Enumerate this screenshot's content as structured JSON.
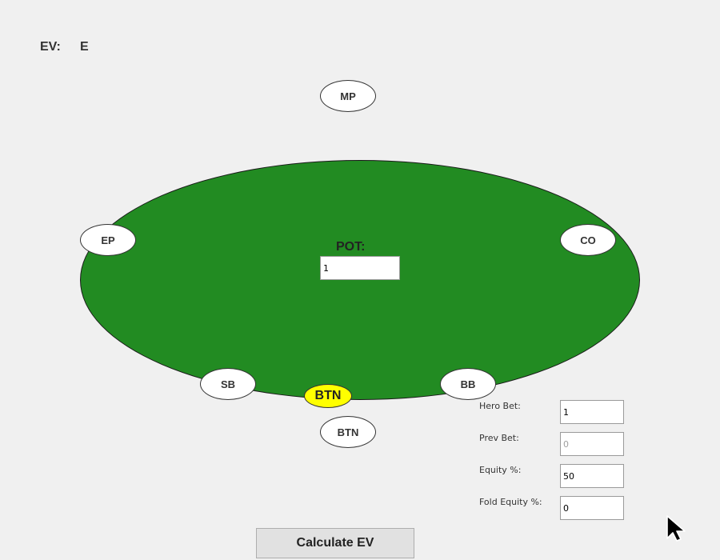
{
  "ev": {
    "label": "EV:",
    "value": "E"
  },
  "table": {
    "pot_label": "POT:",
    "pot_value": "1",
    "felt_color": "#228b22"
  },
  "seats": {
    "mp": "MP",
    "ep": "EP",
    "co": "CO",
    "sb": "SB",
    "bb": "BB",
    "btn": "BTN"
  },
  "dealer_button": {
    "label": "BTN",
    "color": "#ffff00"
  },
  "fields": {
    "hero_bet": {
      "label": "Hero Bet:",
      "value": "1"
    },
    "prev_bet": {
      "label": "Prev Bet:",
      "placeholder": "0"
    },
    "equity": {
      "label": "Equity %:",
      "value": "50"
    },
    "fold_equity": {
      "label": "Fold Equity %:",
      "value": "0"
    }
  },
  "calculate_button": {
    "label": "Calculate EV"
  }
}
